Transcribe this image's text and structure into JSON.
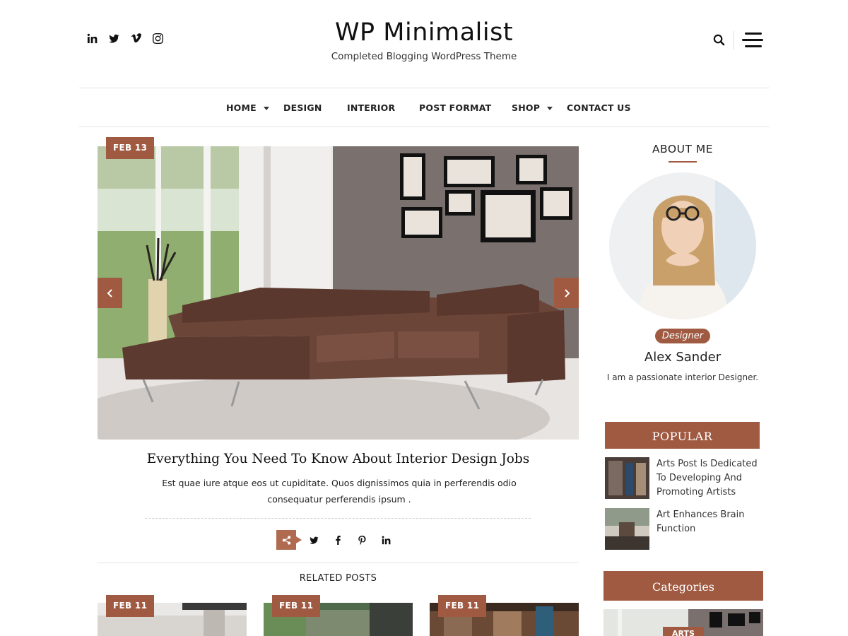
{
  "header": {
    "site_title": "WP Minimalist",
    "tagline": "Completed Blogging WordPress Theme",
    "social": [
      "linkedin-icon",
      "twitter-icon",
      "vimeo-icon",
      "instagram-icon"
    ]
  },
  "nav": {
    "items": [
      {
        "label": "HOME",
        "has_dropdown": true
      },
      {
        "label": "DESIGN",
        "has_dropdown": false
      },
      {
        "label": "INTERIOR",
        "has_dropdown": false
      },
      {
        "label": "POST FORMAT",
        "has_dropdown": false
      },
      {
        "label": "SHOP",
        "has_dropdown": true
      },
      {
        "label": "CONTACT US",
        "has_dropdown": false
      }
    ]
  },
  "slider": {
    "date": "FEB 13",
    "title": "Everything You Need To Know About Interior Design Jobs",
    "excerpt": "Est quae iure atque eos ut cupiditate. Quos dignissimos quia in perferendis odio consequatur perferendis ipsum ."
  },
  "share": {
    "icons": [
      "share-icon",
      "twitter-icon",
      "facebook-icon",
      "pinterest-icon",
      "linkedin-icon"
    ]
  },
  "related": {
    "heading": "RELATED POSTS",
    "posts": [
      {
        "date": "FEB 11"
      },
      {
        "date": "FEB 11"
      },
      {
        "date": "FEB 11"
      }
    ]
  },
  "sidebar": {
    "about": {
      "heading": "ABOUT ME",
      "role": "Designer",
      "name": "Alex Sander",
      "bio": "I am a passionate interior Designer."
    },
    "popular": {
      "heading": "POPULAR",
      "posts": [
        {
          "title": "Arts Post Is Dedicated To Developing And Promoting Artists"
        },
        {
          "title": "Art Enhances Brain Function"
        }
      ]
    },
    "categories": {
      "heading": "Categories",
      "first_badge": "ARTS"
    }
  },
  "colors": {
    "accent": "#a05a42",
    "text": "#222222"
  }
}
